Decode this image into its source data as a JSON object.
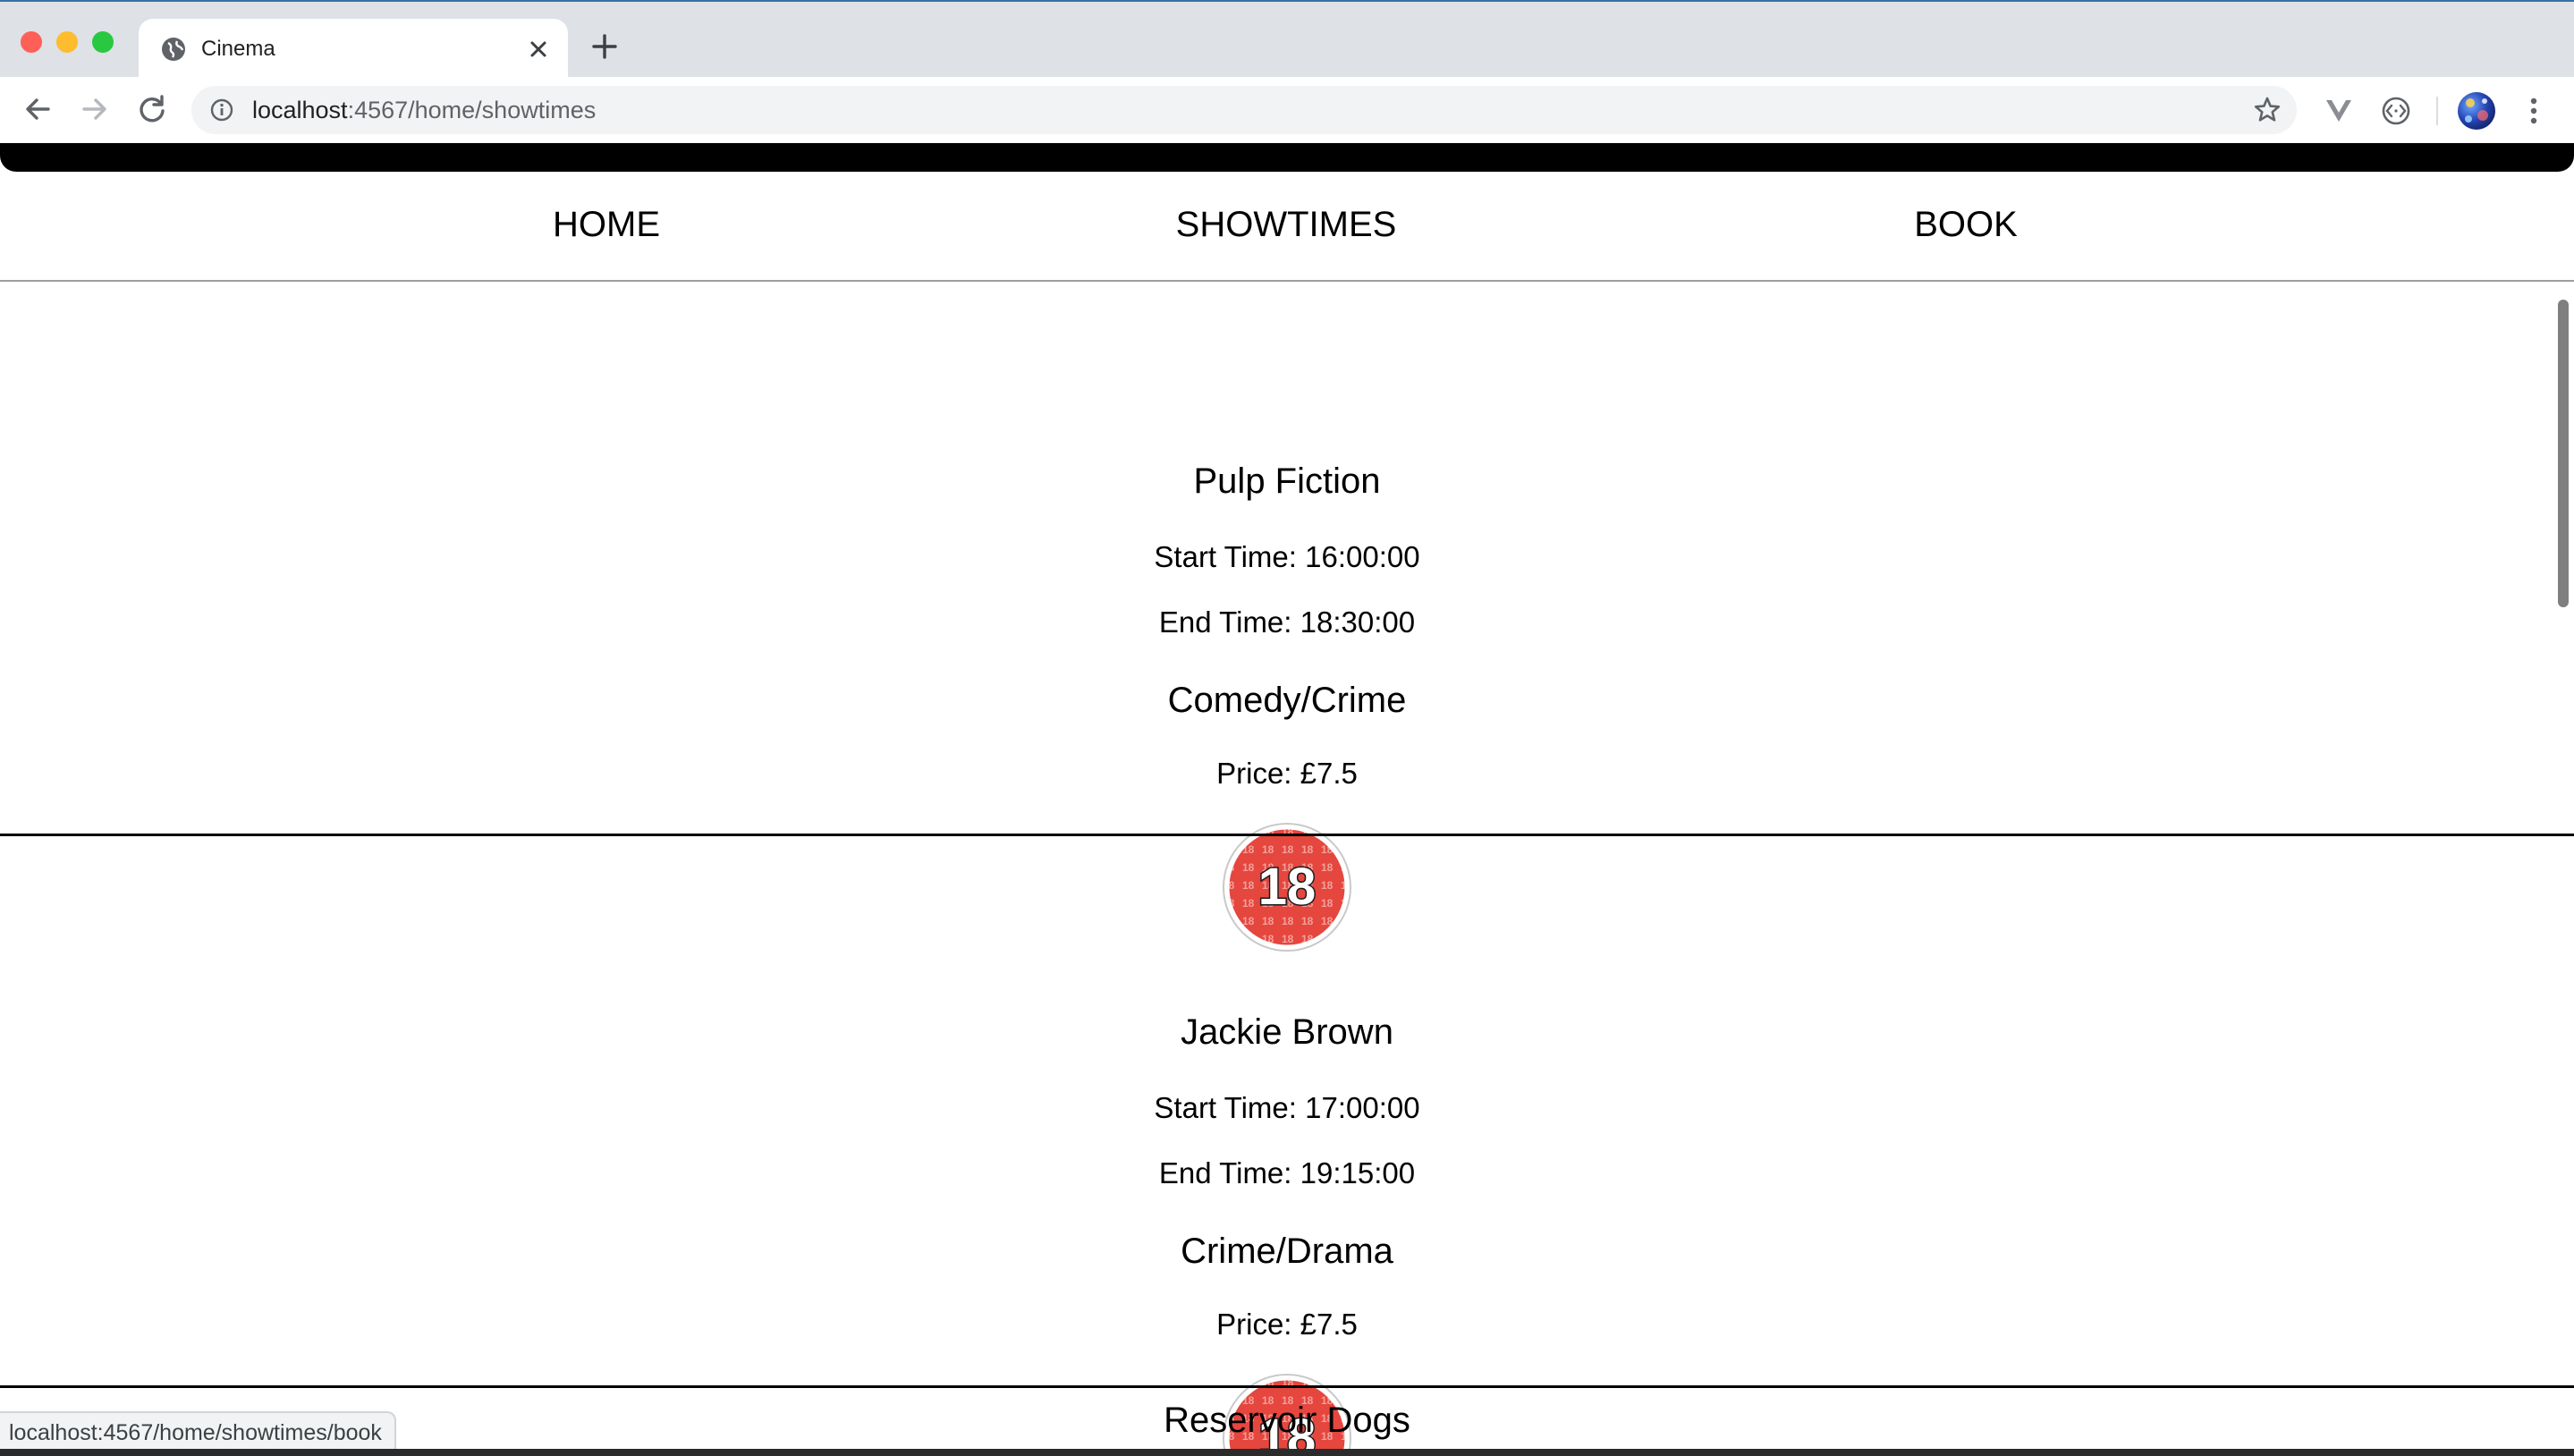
{
  "browser": {
    "tab_title": "Cinema",
    "url_host": "localhost",
    "url_rest": ":4567/home/showtimes",
    "status_url": "localhost:4567/home/showtimes/book",
    "icons": {
      "favicon": "globe-icon",
      "close": "close-icon",
      "new_tab": "plus-icon",
      "back": "arrow-left-icon",
      "forward": "arrow-right-icon",
      "reload": "reload-icon",
      "info": "info-icon",
      "bookmark": "star-icon",
      "extension_1": "vee-extension-icon",
      "extension_2": "code-extension-icon",
      "menu": "kebab-menu-icon"
    }
  },
  "site_nav": {
    "items": [
      {
        "label": "HOME"
      },
      {
        "label": "SHOWTIMES"
      },
      {
        "label": "BOOK"
      }
    ]
  },
  "movies": [
    {
      "title": "Pulp Fiction",
      "start": "Start Time: 16:00:00",
      "end": "End Time: 18:30:00",
      "genre": "Comedy/Crime",
      "price": "Price: £7.5",
      "rating": "18"
    },
    {
      "title": "Jackie Brown",
      "start": "Start Time: 17:00:00",
      "end": "End Time: 19:15:00",
      "genre": "Crime/Drama",
      "price": "Price: £7.5",
      "rating": "18"
    },
    {
      "title": "Reservoir Dogs"
    }
  ],
  "colors": {
    "tabbar": "#dee1e6",
    "omnibox": "#f1f3f4",
    "rating_red": "#e03a3a",
    "divider": "#000000"
  }
}
